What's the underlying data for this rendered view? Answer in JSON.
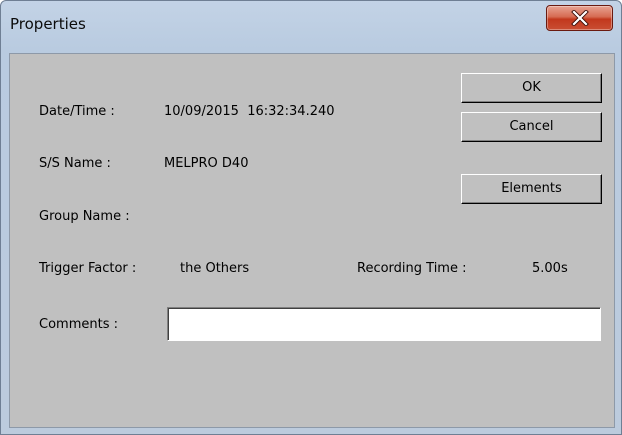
{
  "window": {
    "title": "Properties"
  },
  "labels": {
    "date_time": "Date/Time :",
    "ss_name": "S/S Name :",
    "group_name": "Group Name :",
    "trigger_factor": "Trigger Factor :",
    "recording_time": "Recording Time :",
    "comments": "Comments :"
  },
  "values": {
    "date_time": "10/09/2015  16:32:34.240",
    "ss_name": "MELPRO D40",
    "group_name": "",
    "trigger_factor": "the Others",
    "recording_time": "5.00s",
    "comments": ""
  },
  "buttons": {
    "ok": "OK",
    "cancel": "Cancel",
    "elements": "Elements"
  },
  "icons": {
    "close": "close-icon"
  },
  "colors": {
    "client_background": "#c0c0c0",
    "close_button": "#c94e33"
  }
}
